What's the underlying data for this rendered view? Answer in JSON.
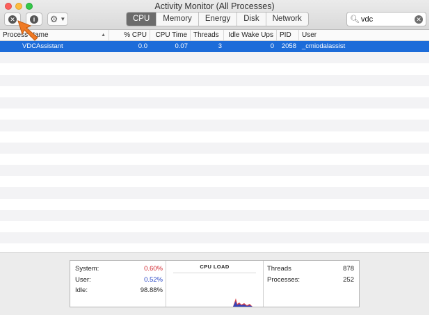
{
  "window": {
    "title": "Activity Monitor (All Processes)"
  },
  "toolbar": {
    "stop_icon": "close-circle-icon",
    "info_icon": "info-circle-icon",
    "action_icon": "gear-icon",
    "tabs": [
      {
        "label": "CPU",
        "active": true
      },
      {
        "label": "Memory",
        "active": false
      },
      {
        "label": "Energy",
        "active": false
      },
      {
        "label": "Disk",
        "active": false
      },
      {
        "label": "Network",
        "active": false
      }
    ],
    "search": {
      "value": "vdc"
    }
  },
  "table": {
    "columns": {
      "name": "Process Name",
      "cpu": "% CPU",
      "time": "CPU Time",
      "threads": "Threads",
      "idle": "Idle Wake Ups",
      "pid": "PID",
      "user": "User"
    },
    "rows": [
      {
        "name": "VDCAssistant",
        "cpu": "0.0",
        "time": "0.07",
        "threads": "3",
        "idle": "0",
        "pid": "2058",
        "user": "_cmiodalassist"
      }
    ]
  },
  "summary": {
    "system_label": "System:",
    "system_value": "0.60%",
    "user_label": "User:",
    "user_value": "0.52%",
    "idle_label": "Idle:",
    "idle_value": "98.88%",
    "load_title": "CPU LOAD",
    "threads_label": "Threads",
    "threads_value": "878",
    "processes_label": "Processes:",
    "processes_value": "252"
  },
  "colors": {
    "selection": "#1d6cd9",
    "system_red": "#d0242c",
    "user_blue": "#2543c4",
    "cursor_orange": "#f07a24"
  }
}
